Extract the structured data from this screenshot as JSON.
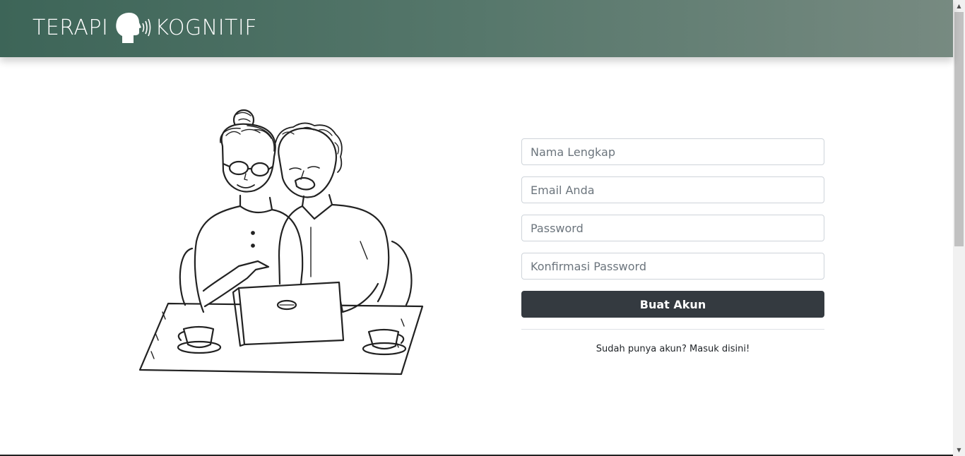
{
  "navbar": {
    "brand_left": "TERAPI",
    "brand_right": "KOGNITIF",
    "brand_icon": "speaking-head-icon"
  },
  "illustration": {
    "description_icon": "couple-laptop-illustration"
  },
  "form": {
    "full_name_placeholder": "Nama Lengkap",
    "email_placeholder": "Email Anda",
    "password_placeholder": "Password",
    "confirm_password_placeholder": "Konfirmasi Password",
    "submit_label": "Buat Akun",
    "login_link": "Sudah punya akun? Masuk disini!"
  },
  "scrollbar": {
    "up_icon": "scroll-up-arrow-icon",
    "down_icon": "scroll-down-arrow-icon"
  },
  "colors": {
    "navbar_start": "#3d6558",
    "navbar_end": "#778a81",
    "button": "#343a40"
  }
}
